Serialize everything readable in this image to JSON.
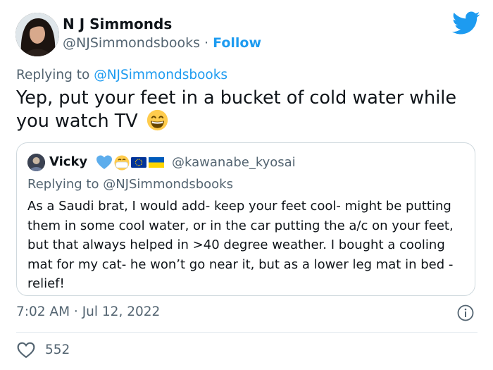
{
  "author": {
    "name": "N J Simmonds",
    "handle": "@NJSimmondsbooks",
    "separator": " · ",
    "follow_label": "Follow"
  },
  "reply_context": {
    "prefix": "Replying to ",
    "handle": "@NJSimmondsbooks"
  },
  "tweet": {
    "text": "Yep, put your feet in a bucket of cold water while you watch TV",
    "emoji": "grinning-face-emoji"
  },
  "quoted": {
    "name": "Vicky",
    "name_emojis": [
      "blue-heart-emoji",
      "mask-face-emoji",
      "eu-flag-emoji",
      "ukraine-flag-emoji"
    ],
    "handle": "@kawanabe_kyosai",
    "reply_prefix": "Replying to ",
    "reply_handle": "@NJSimmondsbooks",
    "text": "As a Saudi brat, I would add- keep your feet cool- might be putting them in some cool water, or in the car putting the a/c on your feet, but that always helped in >40 degree weather. I bought a cooling mat for my cat- he won’t go near it, but as a lower leg mat in bed - relief!"
  },
  "meta": {
    "time": "7:02 AM",
    "date": "Jul 12, 2022",
    "separator": " · "
  },
  "actions": {
    "like_count": "552"
  },
  "colors": {
    "accent": "#1d9bf0",
    "secondary_text": "#536471",
    "border": "#cfd9de"
  }
}
